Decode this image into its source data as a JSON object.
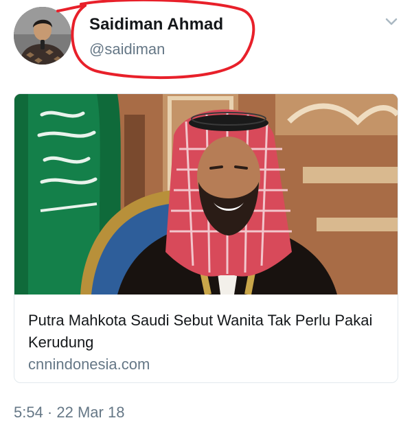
{
  "tweet": {
    "author_name": "Saidiman Ahmad",
    "author_handle": "@saidiman",
    "timestamp": "5:54 · 22 Mar 18"
  },
  "card": {
    "title": "Putra Mahkota Saudi Sebut Wanita Tak Perlu Pakai Kerudung",
    "domain": "cnnindonesia.com"
  },
  "icons": {
    "menu": "chevron-down-icon"
  },
  "colors": {
    "name_text": "#14171a",
    "secondary_text": "#657786",
    "annotation_red": "#e8202a",
    "card_border": "#e1e8ed"
  }
}
